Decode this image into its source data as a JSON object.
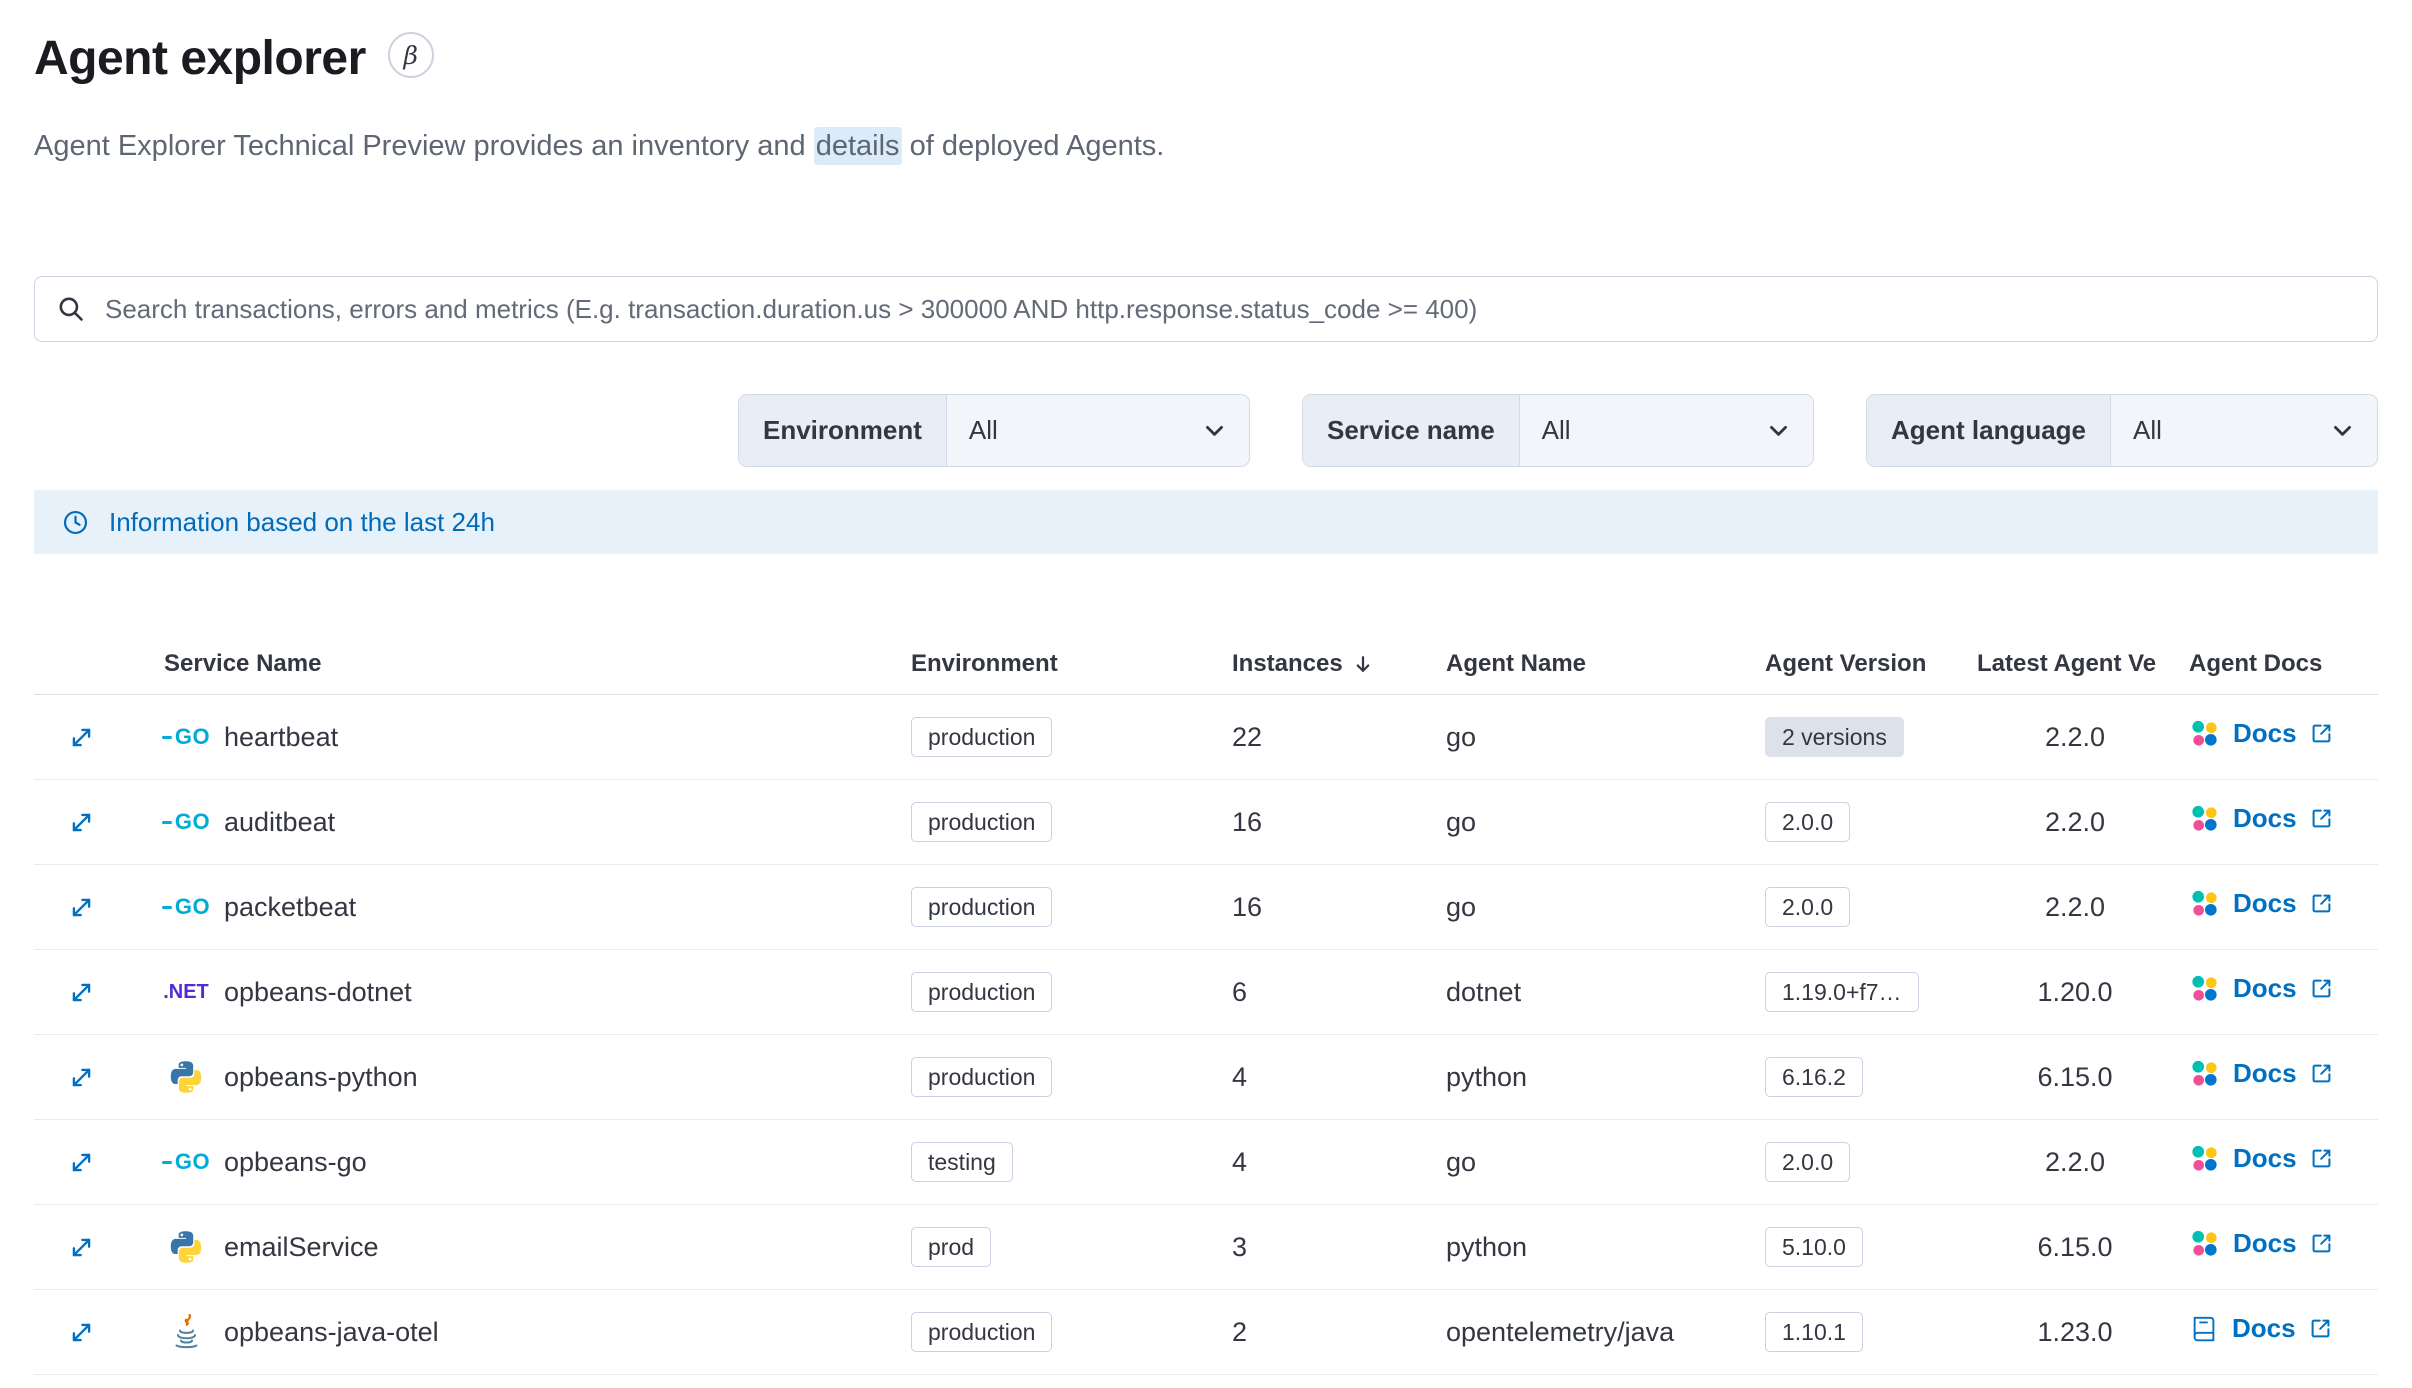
{
  "page": {
    "title": "Agent explorer",
    "beta": "β",
    "subtitle": {
      "before": "Agent Explorer Technical Preview provides an inventory and ",
      "highlight": "details",
      "after": " of deployed Agents."
    }
  },
  "search": {
    "icon": "search-icon",
    "placeholder": "Search transactions, errors and metrics (E.g. transaction.duration.us > 300000 AND http.response.status_code >= 400)"
  },
  "filters": [
    {
      "label": "Environment",
      "value": "All"
    },
    {
      "label": "Service name",
      "value": "All"
    },
    {
      "label": "Agent language",
      "value": "All"
    }
  ],
  "callout": {
    "icon": "clock-icon",
    "text": "Information based on the last 24h"
  },
  "icons": {
    "go_label": "GO",
    "dotnet_label": ".NET"
  },
  "table": {
    "columns": [
      {
        "label": "Service Name"
      },
      {
        "label": "Environment"
      },
      {
        "label": "Instances",
        "sort": "desc"
      },
      {
        "label": "Agent Name"
      },
      {
        "label": "Agent Version"
      },
      {
        "label": "Latest Agent Ve"
      },
      {
        "label": "Agent Docs"
      }
    ],
    "rows": [
      {
        "service": "heartbeat",
        "language": "go",
        "environment": "production",
        "instances": "22",
        "agent_name": "go",
        "agent_version": "2 versions",
        "version_badge": "filled",
        "latest_version": "2.2.0",
        "docs_label": "Docs",
        "docs_icon": "agent-cluster-icon"
      },
      {
        "service": "auditbeat",
        "language": "go",
        "environment": "production",
        "instances": "16",
        "agent_name": "go",
        "agent_version": "2.0.0",
        "version_badge": "hollow",
        "latest_version": "2.2.0",
        "docs_label": "Docs",
        "docs_icon": "agent-cluster-icon"
      },
      {
        "service": "packetbeat",
        "language": "go",
        "environment": "production",
        "instances": "16",
        "agent_name": "go",
        "agent_version": "2.0.0",
        "version_badge": "hollow",
        "latest_version": "2.2.0",
        "docs_label": "Docs",
        "docs_icon": "agent-cluster-icon"
      },
      {
        "service": "opbeans-dotnet",
        "language": "dotnet",
        "environment": "production",
        "instances": "6",
        "agent_name": "dotnet",
        "agent_version": "1.19.0+f7…",
        "version_badge": "hollow",
        "latest_version": "1.20.0",
        "docs_label": "Docs",
        "docs_icon": "agent-cluster-icon"
      },
      {
        "service": "opbeans-python",
        "language": "python",
        "environment": "production",
        "instances": "4",
        "agent_name": "python",
        "agent_version": "6.16.2",
        "version_badge": "hollow",
        "latest_version": "6.15.0",
        "docs_label": "Docs",
        "docs_icon": "agent-cluster-icon"
      },
      {
        "service": "opbeans-go",
        "language": "go",
        "environment": "testing",
        "instances": "4",
        "agent_name": "go",
        "agent_version": "2.0.0",
        "version_badge": "hollow",
        "latest_version": "2.2.0",
        "docs_label": "Docs",
        "docs_icon": "agent-cluster-icon"
      },
      {
        "service": "emailService",
        "language": "python",
        "environment": "prod",
        "instances": "3",
        "agent_name": "python",
        "agent_version": "5.10.0",
        "version_badge": "hollow",
        "latest_version": "6.15.0",
        "docs_label": "Docs",
        "docs_icon": "agent-cluster-icon"
      },
      {
        "service": "opbeans-java-otel",
        "language": "java",
        "environment": "production",
        "instances": "2",
        "agent_name": "opentelemetry/java",
        "agent_version": "1.10.1",
        "version_badge": "hollow",
        "latest_version": "1.23.0",
        "docs_label": "Docs",
        "docs_icon": "book-icon"
      }
    ]
  }
}
